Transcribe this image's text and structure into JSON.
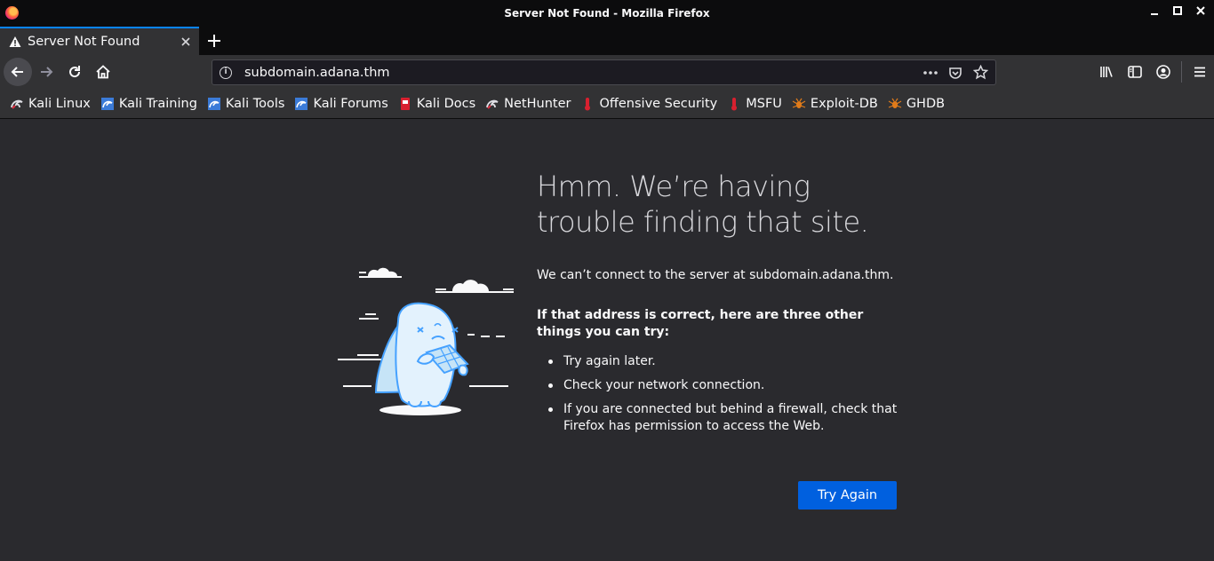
{
  "window": {
    "title": "Server Not Found - Mozilla Firefox"
  },
  "tab": {
    "label": "Server Not Found"
  },
  "urlbar": {
    "url": "subdomain.adana.thm"
  },
  "bookmarks": [
    {
      "label": "Kali Linux",
      "icon": "kali-dragon-icon"
    },
    {
      "label": "Kali Training",
      "icon": "kali-training-icon"
    },
    {
      "label": "Kali Tools",
      "icon": "kali-tools-icon"
    },
    {
      "label": "Kali Forums",
      "icon": "kali-forums-icon"
    },
    {
      "label": "Kali Docs",
      "icon": "kali-docs-icon"
    },
    {
      "label": "NetHunter",
      "icon": "nethunter-icon"
    },
    {
      "label": "Offensive Security",
      "icon": "offsec-icon"
    },
    {
      "label": "MSFU",
      "icon": "msfu-icon"
    },
    {
      "label": "Exploit-DB",
      "icon": "exploit-db-icon"
    },
    {
      "label": "GHDB",
      "icon": "ghdb-icon"
    }
  ],
  "error": {
    "title": "Hmm. We’re having trouble finding that site.",
    "description": "We can’t connect to the server at subdomain.adana.thm.",
    "subhead": "If that address is correct, here are three other things you can try:",
    "tips": [
      "Try again later.",
      "Check your network connection.",
      "If you are connected but behind a firewall, check that Firefox has permission to access the Web."
    ],
    "button": "Try Again"
  },
  "colors": {
    "accent": "#0a84ff",
    "button": "#0060df",
    "background": "#2a2a2e"
  }
}
